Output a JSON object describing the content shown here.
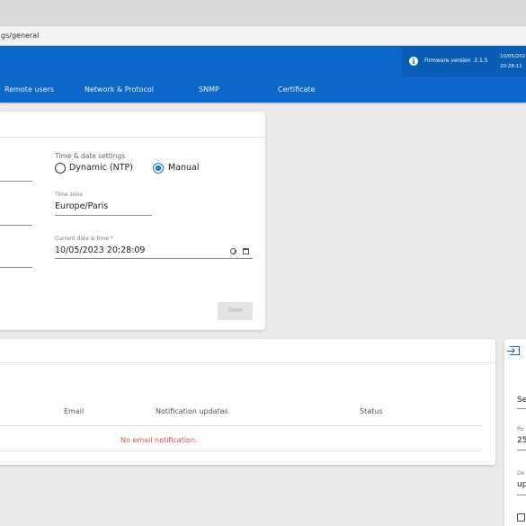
{
  "browser": {
    "url_fragment": "gs/general"
  },
  "header": {
    "firmware_label": "Firmware version",
    "firmware_version": "2.1.5",
    "date_line": "10/05/202",
    "time_line": "20:28:11",
    "info_icon": "info-icon"
  },
  "tabs": [
    {
      "label": "Remote users"
    },
    {
      "label": "Network & Protocol"
    },
    {
      "label": "SNMP"
    },
    {
      "label": "Certificate"
    }
  ],
  "time_settings": {
    "section_label": "Time & date settings",
    "option_dynamic": "Dynamic (NTP)",
    "option_manual": "Manual",
    "selected": "Manual",
    "timezone_label": "Time zone",
    "timezone_value": "Europe/Paris",
    "datetime_label": "Current date & time *",
    "datetime_value": "10/05/2023 20:28:09",
    "save_label": "Save"
  },
  "notifications": {
    "columns": [
      "Email",
      "Notification updates",
      "Status"
    ],
    "empty_message": "No email notification."
  },
  "right_panel": {
    "icon": "login-icon",
    "field1_value": "Se",
    "field2_label": "Po",
    "field2_value": "25",
    "field3_label": "De",
    "field3_value": "up"
  }
}
